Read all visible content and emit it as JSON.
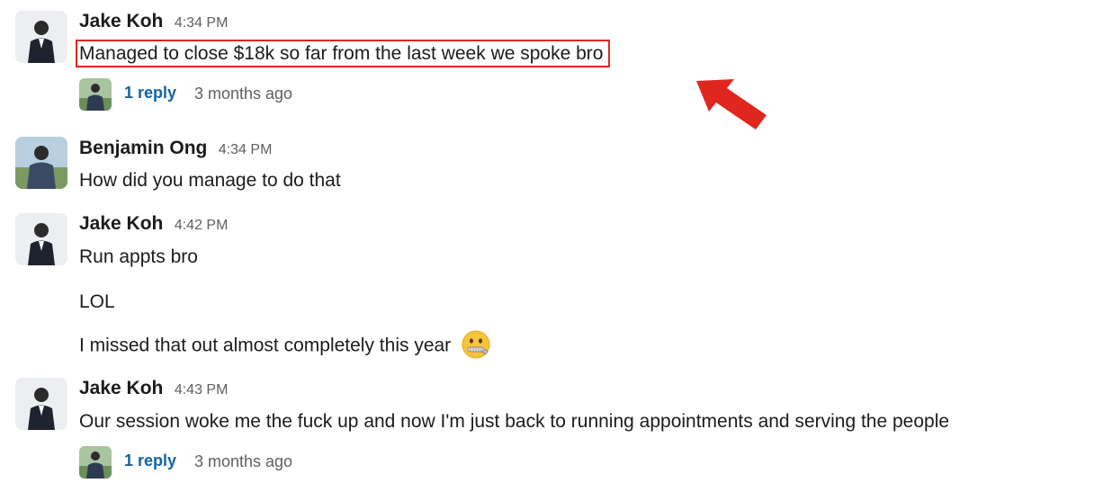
{
  "messages": [
    {
      "author": "Jake Koh",
      "time": "4:34 PM",
      "lines": [
        "Managed to close $18k so far from the last week we spoke bro"
      ],
      "thread": {
        "reply": "1 reply",
        "ago": "3 months ago"
      }
    },
    {
      "author": "Benjamin Ong",
      "time": "4:34 PM",
      "lines": [
        "How did you manage to do that"
      ]
    },
    {
      "author": "Jake Koh",
      "time": "4:42 PM",
      "lines": [
        "Run appts bro",
        "LOL",
        "I missed that out almost completely this year"
      ],
      "emoji": "zipper-mouth-face-icon"
    },
    {
      "author": "Jake Koh",
      "time": "4:43 PM",
      "lines": [
        "Our session woke me the fuck up and now I'm just back to running appointments and serving the people"
      ],
      "thread": {
        "reply": "1 reply",
        "ago": "3 months ago"
      }
    }
  ],
  "annotation": {
    "highlight_color": "#e0271f",
    "arrow_icon": "red-arrow-icon"
  },
  "colors": {
    "link": "#1264a3",
    "muted": "#616061",
    "text": "#1d1c1d"
  }
}
